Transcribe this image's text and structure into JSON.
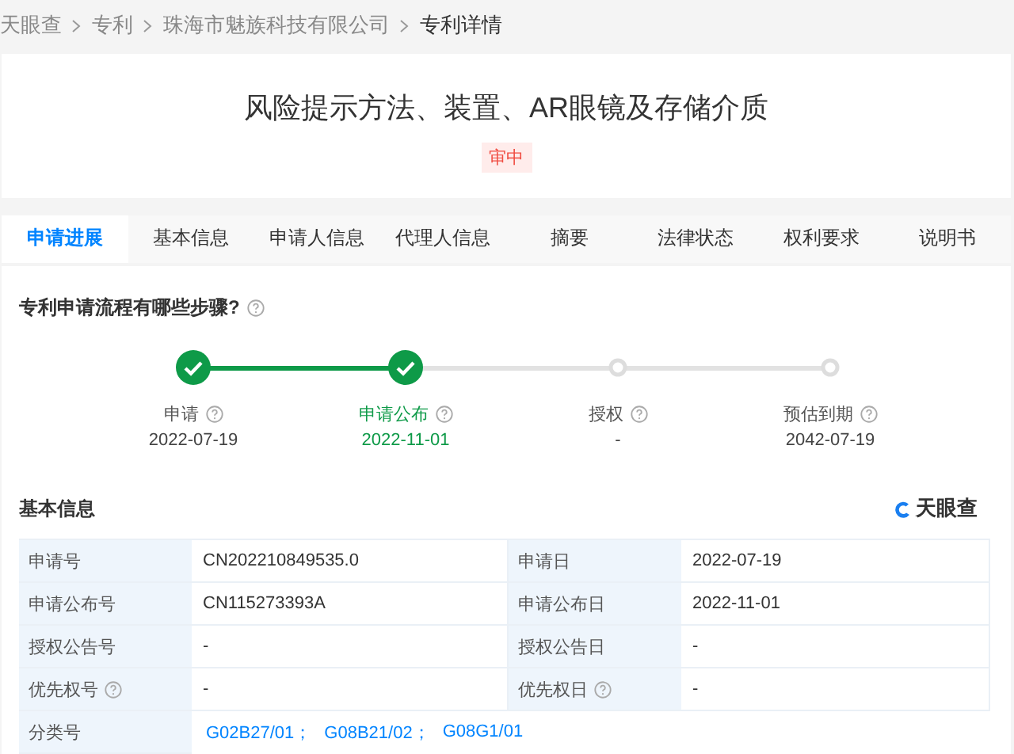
{
  "breadcrumb": [
    "天眼查",
    "专利",
    "珠海市魅族科技有限公司",
    "专利详情"
  ],
  "patent": {
    "title": "风险提示方法、装置、AR眼镜及存储介质",
    "status": "审中"
  },
  "tabs": [
    {
      "label": "申请进展",
      "selected": true
    },
    {
      "label": "基本信息",
      "selected": false
    },
    {
      "label": "申请人信息",
      "selected": false
    },
    {
      "label": "代理人信息",
      "selected": false
    },
    {
      "label": "摘要",
      "selected": false
    },
    {
      "label": "法律状态",
      "selected": false
    },
    {
      "label": "权利要求",
      "selected": false
    },
    {
      "label": "说明书",
      "selected": false
    }
  ],
  "process": {
    "title": "专利申请流程有哪些步骤?",
    "steps": [
      {
        "label": "申请",
        "date": "2022-07-19",
        "done": true,
        "current": false
      },
      {
        "label": "申请公布",
        "date": "2022-11-01",
        "done": true,
        "current": true
      },
      {
        "label": "授权",
        "date": "-",
        "done": false,
        "current": false
      },
      {
        "label": "预估到期",
        "date": "2042-07-19",
        "done": false,
        "current": false
      }
    ]
  },
  "basic_info": {
    "title": "基本信息",
    "logo": "天眼查",
    "rows": [
      [
        {
          "label": "申请号",
          "value": "CN202210849535.0",
          "help": false
        },
        {
          "label": "申请日",
          "value": "2022-07-19",
          "help": false
        }
      ],
      [
        {
          "label": "申请公布号",
          "value": "CN115273393A",
          "help": false
        },
        {
          "label": "申请公布日",
          "value": "2022-11-01",
          "help": false
        }
      ],
      [
        {
          "label": "授权公告号",
          "value": "-",
          "help": false
        },
        {
          "label": "授权公告日",
          "value": "-",
          "help": false
        }
      ],
      [
        {
          "label": "优先权号",
          "value": "-",
          "help": true
        },
        {
          "label": "优先权日",
          "value": "-",
          "help": true
        }
      ]
    ],
    "classification": {
      "label": "分类号",
      "codes": [
        "G02B27/01；",
        "G08B21/02；",
        "G08G1/01"
      ]
    }
  }
}
